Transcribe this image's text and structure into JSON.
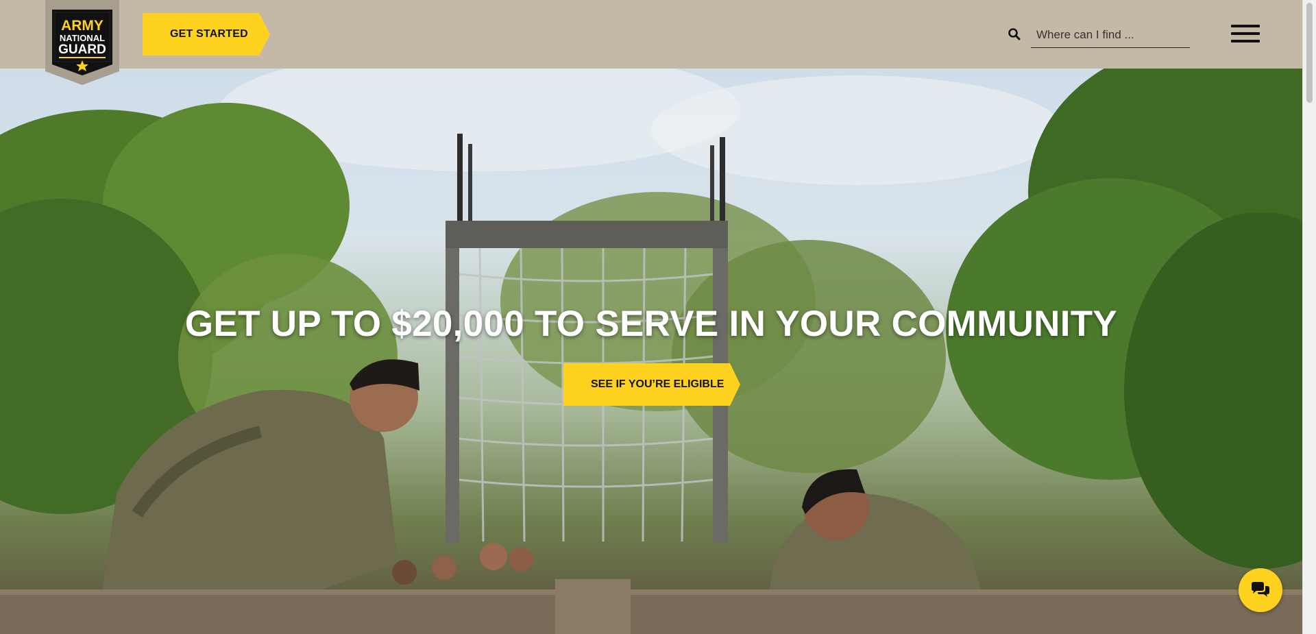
{
  "header": {
    "logo_lines": [
      "ARMY",
      "NATIONAL",
      "GUARD"
    ],
    "get_started_label": "GET STARTED",
    "search": {
      "placeholder": "Where can I find ...",
      "value": ""
    },
    "menu_icon": "hamburger-menu-icon",
    "search_icon": "search-icon"
  },
  "hero": {
    "title": "GET UP TO $20,000 TO SERVE IN YOUR COMMUNITY",
    "cta_label": "SEE IF YOU’RE ELIGIBLE"
  },
  "chat": {
    "icon": "chat-bubbles-icon"
  },
  "colors": {
    "accent": "#ffd21f",
    "header_bg": "#c4b8a6",
    "logo_bg": "#111111",
    "text_dark": "#111111"
  }
}
